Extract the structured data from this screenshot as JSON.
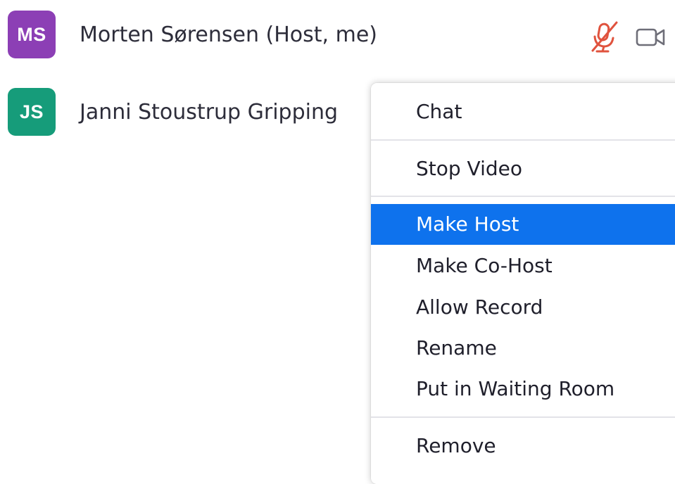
{
  "participants": [
    {
      "initials": "MS",
      "name": "Morten Sørensen (Host, me)",
      "avatar_color": "#8c3fb5",
      "icons": [
        "mic-muted-icon",
        "video-camera-icon"
      ]
    },
    {
      "initials": "JS",
      "name": "Janni Stoustrup Gripping",
      "avatar_color": "#169c7a"
    }
  ],
  "context_menu": {
    "items": [
      {
        "label": "Chat"
      },
      {
        "label": "Stop Video"
      },
      {
        "label": "Make Host",
        "highlighted": true
      },
      {
        "label": "Make Co-Host"
      },
      {
        "label": "Allow Record"
      },
      {
        "label": "Rename"
      },
      {
        "label": "Put in Waiting Room"
      },
      {
        "label": "Remove"
      }
    ]
  },
  "colors": {
    "highlight": "#0e72ed",
    "muted_icon": "#e0533e",
    "camera_icon": "#6e6e78"
  }
}
